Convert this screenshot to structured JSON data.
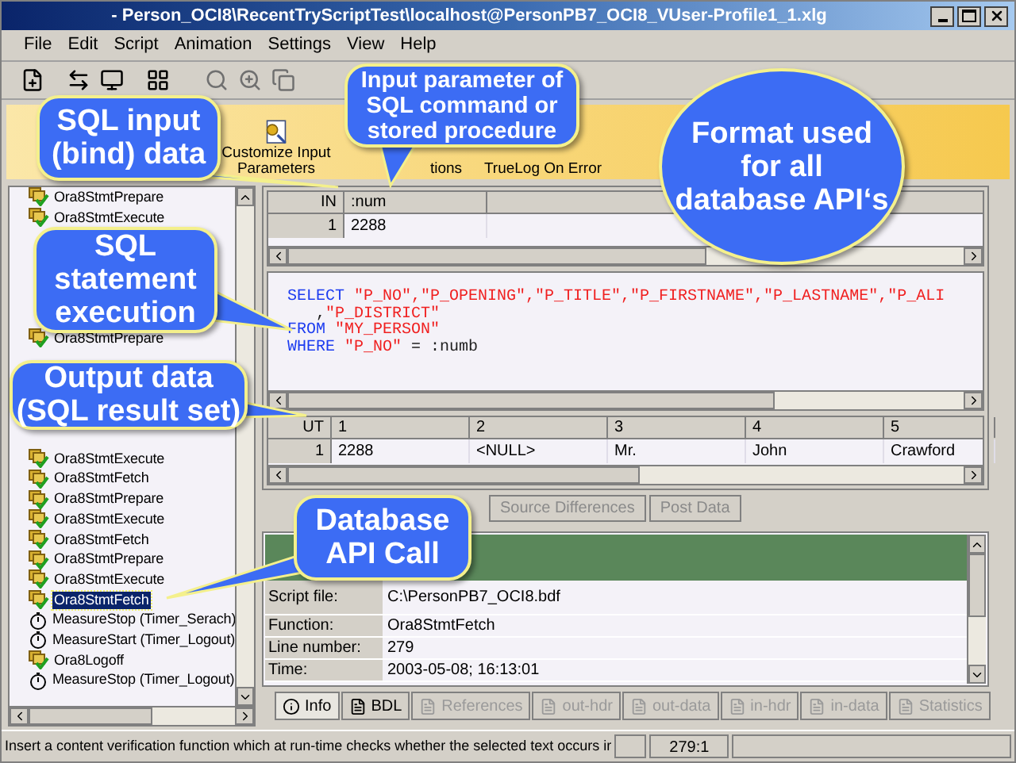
{
  "window": {
    "title": "- Person_OCI8\\RecentTryScriptTest\\localhost@PersonPB7_OCI8_VUser-Profile1_1.xlg"
  },
  "menu": [
    "File",
    "Edit",
    "Script",
    "Animation",
    "Settings",
    "View",
    "Help"
  ],
  "ribbon": [
    {
      "label": "Customize Input Parameters",
      "kind": "customize"
    },
    {
      "label": "tions",
      "kind": "plain"
    },
    {
      "label": "TrueLog On Error",
      "kind": "plain"
    }
  ],
  "tree": {
    "items": [
      {
        "kind": "call",
        "label": "Ora8StmtPrepare",
        "selected": false
      },
      {
        "kind": "call",
        "label": "Ora8StmtExecute",
        "selected": false
      },
      {
        "kind": "call",
        "label": "Ora8StmtPrepare",
        "selected": false
      },
      {
        "kind": "call",
        "label": "Ora8StmtExecute",
        "selected": false
      },
      {
        "kind": "call",
        "label": "Ora8StmtFetch",
        "selected": false
      },
      {
        "kind": "call",
        "label": "Ora8StmtPrepare",
        "selected": false
      },
      {
        "kind": "call",
        "label": "Ora8StmtExecute",
        "selected": false
      },
      {
        "kind": "call",
        "label": "Ora8StmtFetch",
        "selected": false
      },
      {
        "kind": "call",
        "label": "Ora8StmtPrepare",
        "selected": false
      },
      {
        "kind": "call",
        "label": "Ora8StmtExecute",
        "selected": false
      },
      {
        "kind": "call",
        "label": "Ora8StmtFetch",
        "selected": true
      },
      {
        "kind": "timer",
        "label": "MeasureStop (Timer_Serach)",
        "selected": false
      },
      {
        "kind": "timer",
        "label": "MeasureStart (Timer_Logout)",
        "selected": false
      },
      {
        "kind": "call",
        "label": "Ora8Logoff",
        "selected": false
      },
      {
        "kind": "timer",
        "label": "MeasureStop (Timer_Logout)",
        "selected": false
      }
    ]
  },
  "input_grid": {
    "columns": [
      "IN",
      ":num"
    ],
    "rows": [
      [
        "1",
        "2288"
      ]
    ]
  },
  "sql": {
    "lines": [
      [
        {
          "kind": "keyword",
          "text": "SELECT "
        },
        {
          "kind": "string",
          "text": "\"P_NO\",\"P_OPENING\",\"P_TITLE\",\"P_FIRSTNAME\",\"P_LASTNAME\",\"P_ALI"
        }
      ],
      [
        {
          "kind": "plain",
          "text": "   ,"
        },
        {
          "kind": "string",
          "text": "\"P_DISTRICT\""
        }
      ],
      [
        {
          "kind": "keyword",
          "text": "FROM "
        },
        {
          "kind": "string",
          "text": "\"MY_PERSON\""
        }
      ],
      [
        {
          "kind": "keyword",
          "text": "WHERE "
        },
        {
          "kind": "string",
          "text": "\"P_NO\""
        },
        {
          "kind": "plain",
          "text": " = :numb"
        }
      ]
    ]
  },
  "output_grid": {
    "columns": [
      "UT",
      "1",
      "2",
      "3",
      "4",
      "5"
    ],
    "rows": [
      [
        "1",
        "2288",
        "<NULL>",
        "Mr.",
        "John",
        "Crawford"
      ]
    ]
  },
  "view_tabs": [
    {
      "label": "Source Differences",
      "selected": false
    },
    {
      "label": "Post Data",
      "selected": false
    }
  ],
  "info": {
    "rows": [
      {
        "label": "Script file:",
        "value": "C:\\PersonPB7_OCI8.bdf"
      },
      {
        "label": "Function:",
        "value": "Ora8StmtFetch"
      },
      {
        "label": "Line number:",
        "value": "279"
      },
      {
        "label": "Time:",
        "value": "2003-05-08; 16:13:01"
      }
    ]
  },
  "info_tabs": [
    {
      "label": "Info",
      "selected": true,
      "disabled": false
    },
    {
      "label": "BDL",
      "selected": false,
      "disabled": false
    },
    {
      "label": "References",
      "selected": false,
      "disabled": true
    },
    {
      "label": "out-hdr",
      "selected": false,
      "disabled": true
    },
    {
      "label": "out-data",
      "selected": false,
      "disabled": true
    },
    {
      "label": "in-hdr",
      "selected": false,
      "disabled": true
    },
    {
      "label": "in-data",
      "selected": false,
      "disabled": true
    },
    {
      "label": "Statistics",
      "selected": false,
      "disabled": true
    }
  ],
  "status_bar": {
    "message": "Insert a content verification function which at run-time checks whether the selected text occurs ir",
    "position": "279:1"
  },
  "callouts": [
    {
      "kind": "box",
      "lines": [
        "SQL input",
        "(bind) data"
      ]
    },
    {
      "kind": "box",
      "lines": [
        "Input parameter of",
        "SQL command or",
        "stored procedure"
      ]
    },
    {
      "kind": "ellipse",
      "lines": [
        "Format used",
        "for all",
        "database API‘s"
      ]
    },
    {
      "kind": "box",
      "lines": [
        "SQL",
        "statement",
        "execution"
      ]
    },
    {
      "kind": "box",
      "lines": [
        "Output data",
        "(SQL result set)"
      ]
    },
    {
      "kind": "box",
      "lines": [
        "Database",
        "API Call"
      ]
    }
  ]
}
